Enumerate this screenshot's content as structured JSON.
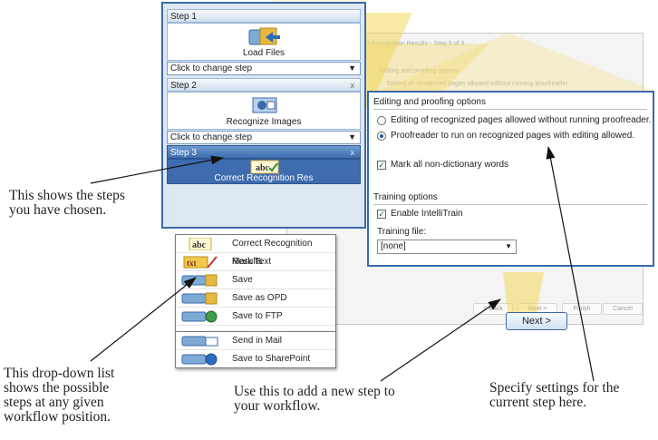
{
  "wizard": {
    "title": "Untitled - Correct Recognition Results - Step 3 of 3",
    "ghost_heading": "Editing and proofing options",
    "ghost_line": "Editing of recognized pages allowed without running proofreader.",
    "buttons": {
      "back": "< Back",
      "next": "Next >",
      "finish": "Finish",
      "cancel": "Cancel"
    }
  },
  "steps": [
    {
      "header": "Step 1",
      "name": "Load Files",
      "select": "Click to change step",
      "icon": "load-files-icon"
    },
    {
      "header": "Step 2",
      "name": "Recognize Images",
      "select": "Click to change step",
      "icon": "recognize-images-icon"
    },
    {
      "header": "Step 3",
      "name": "Correct Recognition Res",
      "icon": "proofread-abc-icon"
    }
  ],
  "dropdown_items": [
    {
      "label": "Correct Recognition Results",
      "icon": "abc-check-icon"
    },
    {
      "label": "Mark Text",
      "icon": "mark-text-icon"
    },
    {
      "label": "Save",
      "icon": "save-folder-icon"
    },
    {
      "label": "Save as OPD",
      "icon": "save-folder-icon"
    },
    {
      "label": "Save to FTP",
      "icon": "save-ftp-icon"
    },
    {
      "label": "Send in Mail",
      "icon": "send-mail-icon"
    },
    {
      "label": "Save to SharePoint",
      "icon": "sharepoint-icon"
    }
  ],
  "settings": {
    "heading": "Editing and proofing options",
    "option1": "Editing of recognized pages allowed without running proofreader.",
    "option2": "Proofreader to run on recognized pages with editing allowed.",
    "mark": "Mark all non-dictionary words",
    "training_heading": "Training options",
    "intellitrain": "Enable IntelliTrain",
    "training_file_label": "Training file:",
    "training_file_value": "[none]"
  },
  "next_label": "Next >",
  "callouts": {
    "steps": "This shows the steps you have chosen.",
    "dropdown": "This drop-down list shows the possible steps at any given workflow position.",
    "add_step": "Use this to add a new step to your workflow.",
    "settings": "Specify settings for the current step here."
  },
  "colors": {
    "accent": "#3b69a8",
    "panel": "#dde8f3",
    "highlight": "#f3d85a"
  }
}
